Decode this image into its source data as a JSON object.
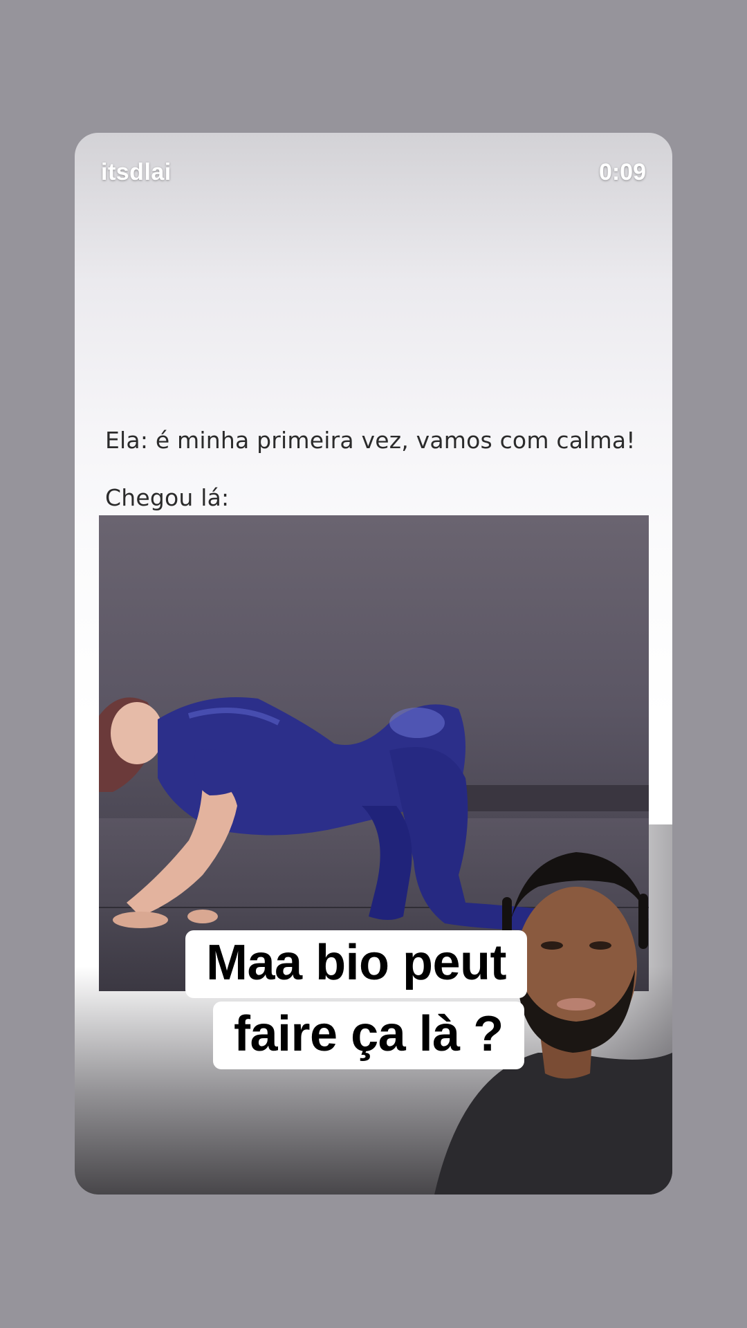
{
  "story": {
    "username": "itsdlai",
    "timer": "0:09"
  },
  "post": {
    "caption_line1": "Ela: é minha primeira vez, vamos com calma!",
    "caption_line2": "Chegou lá:"
  },
  "overlay": {
    "line1": "Maa bio peut",
    "line2": "faire ça là ?"
  },
  "colors": {
    "background": "#96949b",
    "suit": "#2c2f8a"
  }
}
